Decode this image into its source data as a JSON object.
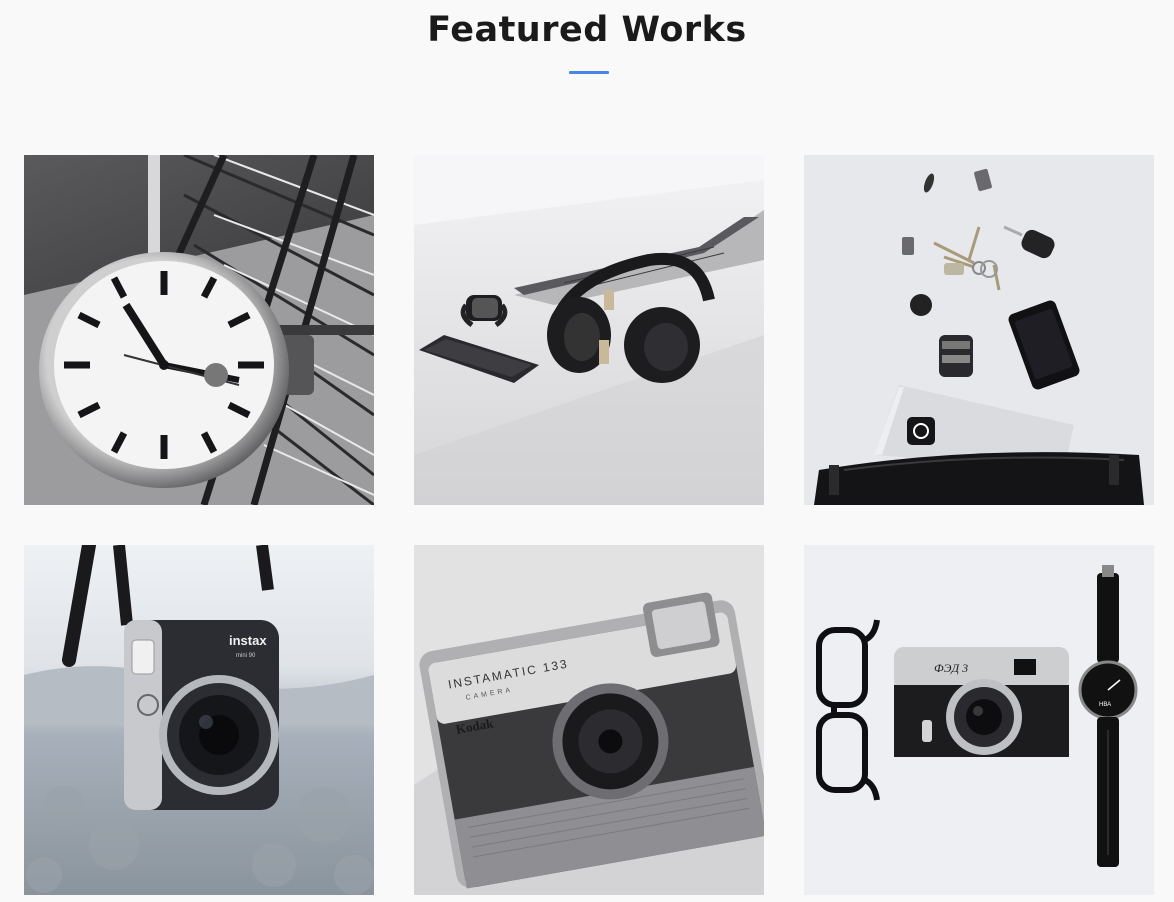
{
  "section": {
    "title": "Featured Works",
    "accent_color": "#4a86e8"
  },
  "works": [
    {
      "subject": "station-clock",
      "icon": "clock-icon"
    },
    {
      "subject": "laptop-headphones-phone",
      "icon": "headphones-icon"
    },
    {
      "subject": "keys-phone-laptop-bag",
      "icon": "keys-icon"
    },
    {
      "subject": "instax-mini-90-camera",
      "icon": "camera-icon",
      "texts": [
        "instax",
        "mini 90"
      ]
    },
    {
      "subject": "kodak-instamatic-camera",
      "icon": "camera-icon",
      "texts": [
        "INSTAMATIC 133",
        "CAMERA",
        "Kodak"
      ]
    },
    {
      "subject": "fed-3-camera-glasses-watch",
      "icon": "camera-icon",
      "texts": [
        "ФЭД 3",
        "НВА"
      ]
    }
  ]
}
